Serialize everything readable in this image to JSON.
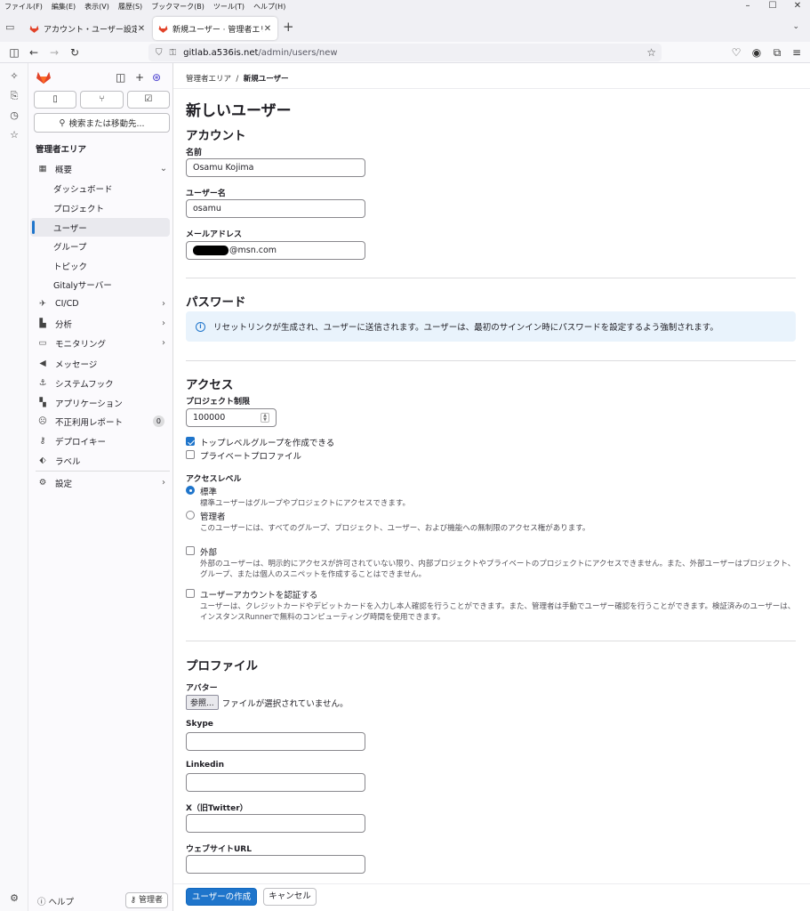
{
  "menubar": [
    "ファイル(F)",
    "編集(E)",
    "表示(V)",
    "履歴(S)",
    "ブックマーク(B)",
    "ツール(T)",
    "ヘルプ(H)"
  ],
  "tabs": [
    {
      "title": "アカウント・ユーザー設定 · GitLab"
    },
    {
      "title": "新規ユーザー · 管理者エリア · GitLab"
    }
  ],
  "url": {
    "host": "gitlab.a536is.net",
    "path": "/admin/users/new"
  },
  "sidebar": {
    "search_label": "検索または移動先...",
    "heading": "管理者エリア",
    "items": [
      {
        "label": "概要"
      },
      {
        "label": "ダッシュボード"
      },
      {
        "label": "プロジェクト"
      },
      {
        "label": "ユーザー"
      },
      {
        "label": "グループ"
      },
      {
        "label": "トピック"
      },
      {
        "label": "Gitalyサーバー"
      },
      {
        "label": "CI/CD"
      },
      {
        "label": "分析"
      },
      {
        "label": "モニタリング"
      },
      {
        "label": "メッセージ"
      },
      {
        "label": "システムフック"
      },
      {
        "label": "アプリケーション"
      },
      {
        "label": "不正利用レポート",
        "count": "0"
      },
      {
        "label": "デプロイキー"
      },
      {
        "label": "ラベル"
      },
      {
        "label": "設定"
      }
    ],
    "help_label": "ヘルプ",
    "admin_label": "管理者"
  },
  "breadcrumb": {
    "root": "管理者エリア",
    "current": "新規ユーザー"
  },
  "page_title": "新しいユーザー",
  "account": {
    "heading": "アカウント",
    "name_label": "名前",
    "name_value": "Osamu Kojima",
    "username_label": "ユーザー名",
    "username_value": "osamu",
    "email_label": "メールアドレス",
    "email_value": "@msn.com"
  },
  "password": {
    "heading": "パスワード",
    "alert": "リセットリンクが生成され、ユーザーに送信されます。ユーザーは、最初のサインイン時にパスワードを設定するよう強制されます。"
  },
  "access": {
    "heading": "アクセス",
    "project_limit_label": "プロジェクト制限",
    "project_limit_value": "100000",
    "can_create_group": "トップレベルグループを作成できる",
    "private_profile": "プライベートプロファイル",
    "level_label": "アクセスレベル",
    "regular_title": "標準",
    "regular_help": "標準ユーザーはグループやプロジェクトにアクセスできます。",
    "admin_title": "管理者",
    "admin_help": "このユーザーには、すべてのグループ、プロジェクト、ユーザー、および機能への無制限のアクセス権があります。",
    "external_title": "外部",
    "external_help": "外部のユーザーは、明示的にアクセスが許可されていない限り、内部プロジェクトやプライベートのプロジェクトにアクセスできません。また、外部ユーザーはプロジェクト、グループ、または個人のスニペットを作成することはできません。",
    "validate_title": "ユーザーアカウントを認証する",
    "validate_help": "ユーザーは、クレジットカードやデビットカードを入力し本人確認を行うことができます。また、管理者は手動でユーザー確認を行うことができます。検証済みのユーザーは、インスタンスRunnerで無料のコンピューティング時間を使用できます。"
  },
  "profile": {
    "heading": "プロファイル",
    "avatar_label": "アバター",
    "browse_label": "参照...",
    "no_file": "ファイルが選択されていません。",
    "skype_label": "Skype",
    "linkedin_label": "Linkedin",
    "twitter_label": "X（旧Twitter）",
    "website_label": "ウェブサイトURL"
  },
  "actions": {
    "create": "ユーザーの作成",
    "cancel": "キャンセル"
  }
}
